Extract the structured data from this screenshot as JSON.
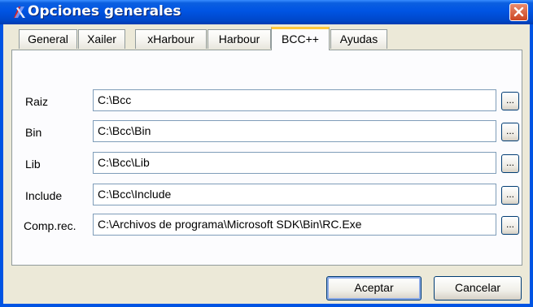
{
  "window": {
    "title": "Opciones generales",
    "close_icon": "close-icon",
    "app_icon": "xailer-icon"
  },
  "tabs": [
    {
      "label": "General"
    },
    {
      "label": "Xailer"
    },
    {
      "label": "xHarbour"
    },
    {
      "label": "Harbour"
    },
    {
      "label": "BCC++",
      "active": true
    },
    {
      "label": "Ayudas"
    }
  ],
  "fields": [
    {
      "label": "Raiz",
      "value": "C:\\Bcc",
      "browse": "..."
    },
    {
      "label": "Bin",
      "value": "C:\\Bcc\\Bin",
      "browse": "..."
    },
    {
      "label": "Lib",
      "value": "C:\\Bcc\\Lib",
      "browse": "..."
    },
    {
      "label": "Include",
      "value": "C:\\Bcc\\Include",
      "browse": "..."
    },
    {
      "label": "Comp.rec.",
      "value": "C:\\Archivos de programa\\Microsoft SDK\\Bin\\RC.Exe",
      "browse": "..."
    }
  ],
  "buttons": {
    "accept": "Aceptar",
    "cancel": "Cancelar"
  },
  "colors": {
    "titlebar": "#0054e3",
    "active_tab_accent": "#ffc83c",
    "dialog_bg": "#ece9d8"
  }
}
